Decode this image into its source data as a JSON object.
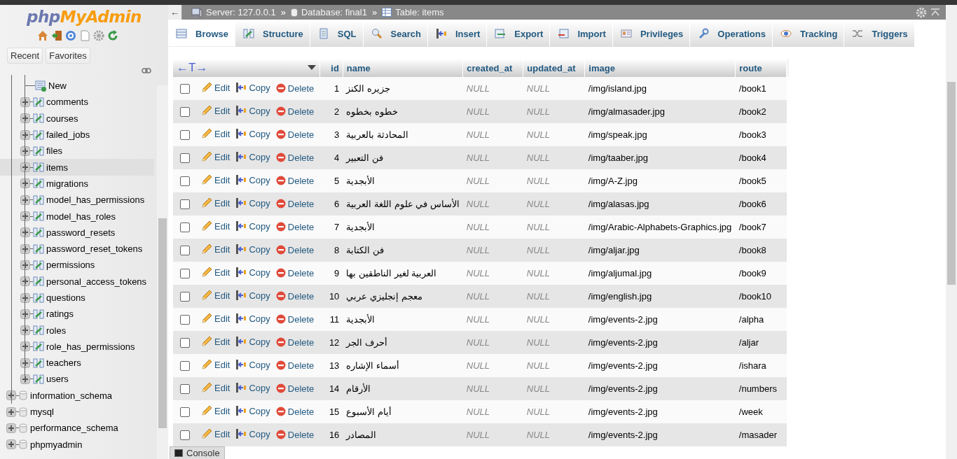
{
  "sidebar": {
    "logo": [
      "php",
      "MyAdmin"
    ],
    "buttons": [
      {
        "label": "Recent"
      },
      {
        "label": "Favorites"
      }
    ],
    "tables": [
      {
        "label": "New",
        "kind": "new",
        "selected": false
      },
      {
        "label": "comments",
        "kind": "table",
        "selected": false
      },
      {
        "label": "courses",
        "kind": "table",
        "selected": false
      },
      {
        "label": "failed_jobs",
        "kind": "table",
        "selected": false
      },
      {
        "label": "files",
        "kind": "table",
        "selected": false
      },
      {
        "label": "items",
        "kind": "table",
        "selected": true
      },
      {
        "label": "migrations",
        "kind": "table",
        "selected": false
      },
      {
        "label": "model_has_permissions",
        "kind": "table",
        "selected": false
      },
      {
        "label": "model_has_roles",
        "kind": "table",
        "selected": false
      },
      {
        "label": "password_resets",
        "kind": "table",
        "selected": false
      },
      {
        "label": "password_reset_tokens",
        "kind": "table",
        "selected": false
      },
      {
        "label": "permissions",
        "kind": "table",
        "selected": false
      },
      {
        "label": "personal_access_tokens",
        "kind": "table",
        "selected": false
      },
      {
        "label": "questions",
        "kind": "table",
        "selected": false
      },
      {
        "label": "ratings",
        "kind": "table",
        "selected": false
      },
      {
        "label": "roles",
        "kind": "table",
        "selected": false
      },
      {
        "label": "role_has_permissions",
        "kind": "table",
        "selected": false
      },
      {
        "label": "teachers",
        "kind": "table",
        "selected": false
      },
      {
        "label": "users",
        "kind": "table",
        "selected": false
      }
    ],
    "databases": [
      {
        "label": "information_schema"
      },
      {
        "label": "mysql"
      },
      {
        "label": "performance_schema"
      },
      {
        "label": "phpmyadmin"
      }
    ]
  },
  "breadcrumb": {
    "collapse": "←",
    "items": [
      {
        "kind": "server",
        "label": "Server: 127.0.0.1"
      },
      {
        "kind": "database",
        "label": "Database: final1"
      },
      {
        "kind": "table",
        "label": "Table: items"
      }
    ],
    "separators": [
      "»",
      "»"
    ]
  },
  "tabs": [
    {
      "label": "Browse",
      "selected": true
    },
    {
      "label": "Structure",
      "selected": false
    },
    {
      "label": "SQL",
      "selected": false
    },
    {
      "label": "Search",
      "selected": false
    },
    {
      "label": "Insert",
      "selected": false
    },
    {
      "label": "Export",
      "selected": false
    },
    {
      "label": "Import",
      "selected": false
    },
    {
      "label": "Privileges",
      "selected": false
    },
    {
      "label": "Operations",
      "selected": false
    },
    {
      "label": "Tracking",
      "selected": false
    },
    {
      "label": "Triggers",
      "selected": false
    }
  ],
  "table": {
    "column_toggle": "←T→",
    "columns": [
      "id",
      "name",
      "created_at",
      "updated_at",
      "image",
      "route"
    ],
    "rows": [
      {
        "checked": false,
        "actions": [
          "Edit",
          "Copy",
          "Delete"
        ],
        "cells": [
          "1",
          "جزيره الكنز",
          "NULL",
          "NULL",
          "/img/island.jpg",
          "/book1"
        ]
      },
      {
        "checked": false,
        "actions": [
          "Edit",
          "Copy",
          "Delete"
        ],
        "cells": [
          "2",
          "خطوه بخطوه",
          "NULL",
          "NULL",
          "/img/almasader.jpg",
          "/book2"
        ]
      },
      {
        "checked": false,
        "actions": [
          "Edit",
          "Copy",
          "Delete"
        ],
        "cells": [
          "3",
          "المحادثة بالعربية",
          "NULL",
          "NULL",
          "/img/speak.jpg",
          "/book3"
        ]
      },
      {
        "checked": false,
        "actions": [
          "Edit",
          "Copy",
          "Delete"
        ],
        "cells": [
          "4",
          "فن التعبير",
          "NULL",
          "NULL",
          "/img/taaber.jpg",
          "/book4"
        ]
      },
      {
        "checked": false,
        "actions": [
          "Edit",
          "Copy",
          "Delete"
        ],
        "cells": [
          "5",
          "الأبجدية",
          "NULL",
          "NULL",
          "/img/A-Z.jpg",
          "/book5"
        ]
      },
      {
        "checked": false,
        "actions": [
          "Edit",
          "Copy",
          "Delete"
        ],
        "cells": [
          "6",
          "الأساس في علوم اللغة العربية",
          "NULL",
          "NULL",
          "/img/alasas.jpg",
          "/book6"
        ]
      },
      {
        "checked": false,
        "actions": [
          "Edit",
          "Copy",
          "Delete"
        ],
        "cells": [
          "7",
          "الأبجدية",
          "NULL",
          "NULL",
          "/img/Arabic-Alphabets-Graphics.jpg",
          "/book7"
        ]
      },
      {
        "checked": false,
        "actions": [
          "Edit",
          "Copy",
          "Delete"
        ],
        "cells": [
          "8",
          "فن الكتابة",
          "NULL",
          "NULL",
          "/img/aljar.jpg",
          "/book8"
        ]
      },
      {
        "checked": false,
        "actions": [
          "Edit",
          "Copy",
          "Delete"
        ],
        "cells": [
          "9",
          "العربية لغير الناطقين بها",
          "NULL",
          "NULL",
          "/img/aljumal.jpg",
          "/book9"
        ]
      },
      {
        "checked": false,
        "actions": [
          "Edit",
          "Copy",
          "Delete"
        ],
        "cells": [
          "10",
          "معجم إنجليزي عربي",
          "NULL",
          "NULL",
          "/img/english.jpg",
          "/book10"
        ]
      },
      {
        "checked": false,
        "actions": [
          "Edit",
          "Copy",
          "Delete"
        ],
        "cells": [
          "11",
          "الأبجدية",
          "NULL",
          "NULL",
          "/img/events-2.jpg",
          "/alpha"
        ]
      },
      {
        "checked": false,
        "actions": [
          "Edit",
          "Copy",
          "Delete"
        ],
        "cells": [
          "12",
          "أحرف الجر",
          "NULL",
          "NULL",
          "/img/events-2.jpg",
          "/aljar"
        ]
      },
      {
        "checked": false,
        "actions": [
          "Edit",
          "Copy",
          "Delete"
        ],
        "cells": [
          "13",
          "أسماء الإشاره",
          "NULL",
          "NULL",
          "/img/events-2.jpg",
          "/ishara"
        ]
      },
      {
        "checked": false,
        "actions": [
          "Edit",
          "Copy",
          "Delete"
        ],
        "cells": [
          "14",
          "الأرقام",
          "NULL",
          "NULL",
          "/img/events-2.jpg",
          "/numbers"
        ]
      },
      {
        "checked": false,
        "actions": [
          "Edit",
          "Copy",
          "Delete"
        ],
        "cells": [
          "15",
          "أيام الأسبوع",
          "NULL",
          "NULL",
          "/img/events-2.jpg",
          "/week"
        ]
      },
      {
        "checked": false,
        "actions": [
          "Edit",
          "Copy",
          "Delete"
        ],
        "cells": [
          "16",
          "المصادر",
          "NULL",
          "NULL",
          "/img/events-2.jpg",
          "/masader"
        ]
      }
    ]
  },
  "console": {
    "label": "Console"
  }
}
